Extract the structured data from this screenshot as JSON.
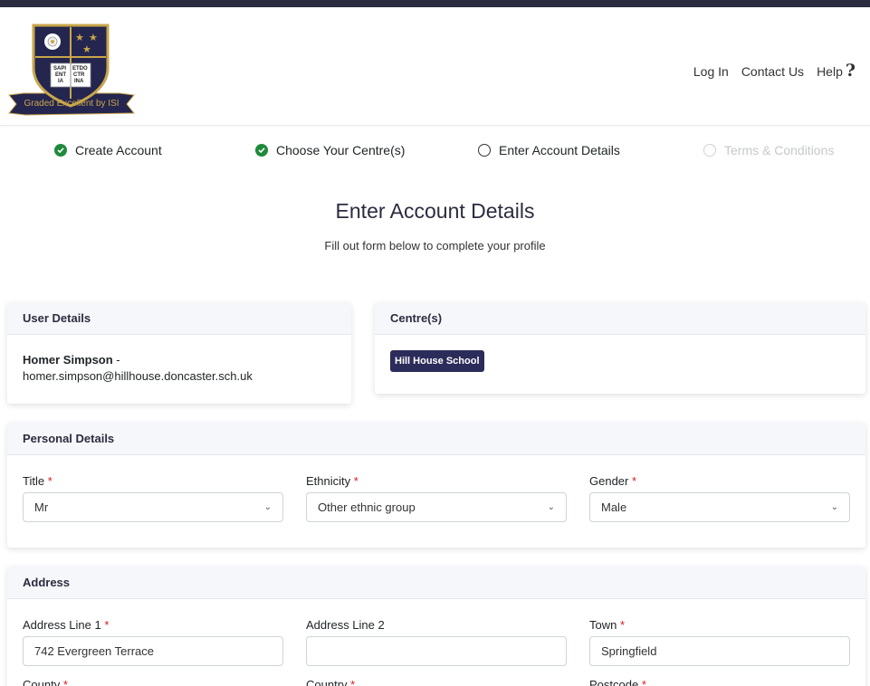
{
  "header": {
    "logo": {
      "motto_line1": "SAPI",
      "motto_line2": "ENT",
      "motto_line3": "IA",
      "motto_line4": "ETDO",
      "motto_line5": "CTR",
      "motto_line6": "INA",
      "ribbon": "Graded Excellent by ISI"
    },
    "nav": {
      "login": "Log In",
      "contact": "Contact Us",
      "help": "Help"
    }
  },
  "steps": [
    {
      "label": "Create Account",
      "state": "complete"
    },
    {
      "label": "Choose Your Centre(s)",
      "state": "complete"
    },
    {
      "label": "Enter Account Details",
      "state": "current"
    },
    {
      "label": "Terms & Conditions",
      "state": "disabled"
    }
  ],
  "page": {
    "title": "Enter Account Details",
    "subtitle": "Fill out form below to complete your profile"
  },
  "user_details": {
    "heading": "User Details",
    "name": "Homer Simpson",
    "separator": " -",
    "email": "homer.simpson@hillhouse.doncaster.sch.uk"
  },
  "centres": {
    "heading": "Centre(s)",
    "badge": "Hill House School"
  },
  "personal": {
    "heading": "Personal Details",
    "title": {
      "label": "Title",
      "value": "Mr"
    },
    "ethnicity": {
      "label": "Ethnicity",
      "value": "Other ethnic group"
    },
    "gender": {
      "label": "Gender",
      "value": "Male"
    }
  },
  "address": {
    "heading": "Address",
    "line1": {
      "label": "Address Line 1",
      "value": "742 Evergreen Terrace"
    },
    "line2": {
      "label": "Address Line 2",
      "value": ""
    },
    "town": {
      "label": "Town",
      "value": "Springfield"
    },
    "county": {
      "label": "County"
    },
    "country": {
      "label": "Country"
    },
    "postcode": {
      "label": "Postcode"
    }
  },
  "required_mark": "*",
  "colors": {
    "navy": "#2b2c3f",
    "badge": "#2b2c5a",
    "check_green": "#1f8a3b",
    "required_red": "#d71d1d",
    "gold": "#c9a64a"
  }
}
